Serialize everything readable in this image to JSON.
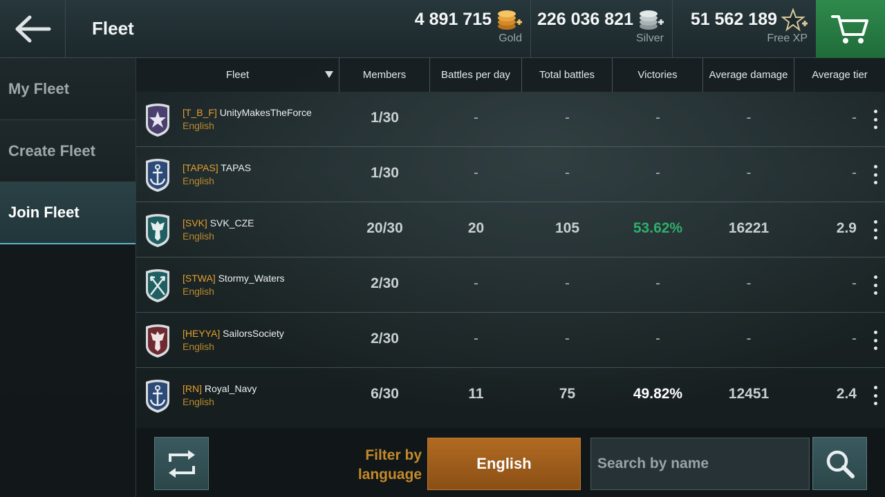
{
  "header": {
    "title": "Fleet",
    "gold": {
      "amount": "4 891 715",
      "label": "Gold"
    },
    "silver": {
      "amount": "226 036 821",
      "label": "Silver"
    },
    "free_xp": {
      "amount": "51 562 189",
      "label": "Free XP"
    }
  },
  "sidebar": {
    "items": [
      {
        "label": "My Fleet",
        "active": false
      },
      {
        "label": "Create Fleet",
        "active": false
      },
      {
        "label": "Join Fleet",
        "active": true
      }
    ]
  },
  "table": {
    "columns": [
      "Fleet",
      "Members",
      "Battles per day",
      "Total battles",
      "Victories",
      "Average damage",
      "Average tier"
    ],
    "rows": [
      {
        "tag": "[T_B_F]",
        "name": "UnityMakesTheForce",
        "language": "English",
        "members": "1/30",
        "battles_per_day": "-",
        "total_battles": "-",
        "victories": "-",
        "avg_damage": "-",
        "avg_tier": "-",
        "emblem": "star-emblem-icon",
        "emblem_color": "#4a3f6e"
      },
      {
        "tag": "[TAPAS]",
        "name": "TAPAS",
        "language": "English",
        "members": "1/30",
        "battles_per_day": "-",
        "total_battles": "-",
        "victories": "-",
        "avg_damage": "-",
        "avg_tier": "-",
        "emblem": "anchor-emblem-icon",
        "emblem_color": "#2c4a78"
      },
      {
        "tag": "[SVK]",
        "name": "SVK_CZE",
        "language": "English",
        "members": "20/30",
        "battles_per_day": "20",
        "total_battles": "105",
        "victories": "53.62%",
        "avg_damage": "16221",
        "avg_tier": "2.9",
        "emblem": "eagle-emblem-icon",
        "emblem_color": "#1f5f62"
      },
      {
        "tag": "[STWA]",
        "name": "Stormy_Waters",
        "language": "English",
        "members": "2/30",
        "battles_per_day": "-",
        "total_battles": "-",
        "victories": "-",
        "avg_damage": "-",
        "avg_tier": "-",
        "emblem": "crossed-arrows-emblem-icon",
        "emblem_color": "#1f5f62"
      },
      {
        "tag": "[HEYYA]",
        "name": "SailorsSociety",
        "language": "English",
        "members": "2/30",
        "battles_per_day": "-",
        "total_battles": "-",
        "victories": "-",
        "avg_damage": "-",
        "avg_tier": "-",
        "emblem": "eagle-emblem-icon",
        "emblem_color": "#6e2a30"
      },
      {
        "tag": "[RN]",
        "name": "Royal_Navy",
        "language": "English",
        "members": "6/30",
        "battles_per_day": "11",
        "total_battles": "75",
        "victories": "49.82%",
        "avg_damage": "12451",
        "avg_tier": "2.4",
        "emblem": "anchor-emblem-icon",
        "emblem_color": "#2c4a78"
      }
    ]
  },
  "filter": {
    "label": "Filter by language",
    "selected_language": "English",
    "search_placeholder": "Search by name"
  },
  "colors": {
    "accent_orange": "#e5a02b",
    "victory_green": "#2fae6b",
    "cart_green": "#2f8a4c",
    "active_sidebar": "#2a4146"
  }
}
